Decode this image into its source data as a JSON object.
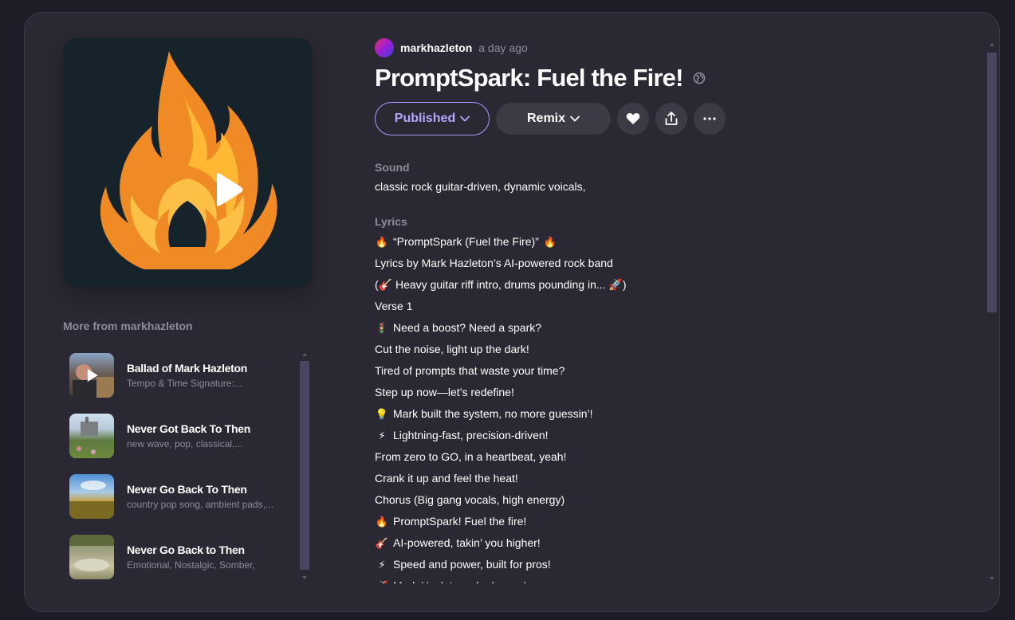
{
  "song": {
    "author": "markhazleton",
    "time": "a day ago",
    "title": "PromptSpark: Fuel the Fire!"
  },
  "actions": {
    "published_label": "Published",
    "remix_label": "Remix"
  },
  "sound": {
    "label": "Sound",
    "text": "classic rock guitar-driven, dynamic voicals,"
  },
  "lyrics": {
    "label": "Lyrics",
    "lines": [
      {
        "pre": "🔥",
        "text": "“PromptSpark (Fuel the Fire)”",
        "post": "🔥"
      },
      {
        "pre": "",
        "text": "Lyrics by Mark Hazleton’s AI-powered rock band",
        "post": ""
      },
      {
        "pre": "",
        "text": "(🎸 Heavy guitar riff intro, drums pounding in... 🚀)",
        "post": ""
      },
      {
        "pre": "",
        "text": "Verse 1",
        "post": ""
      },
      {
        "pre": "🚦",
        "text": "Need a boost? Need a spark?",
        "post": ""
      },
      {
        "pre": "",
        "text": "Cut the noise, light up the dark!",
        "post": ""
      },
      {
        "pre": "",
        "text": "Tired of prompts that waste your time?",
        "post": ""
      },
      {
        "pre": "",
        "text": "Step up now—let’s redefine!",
        "post": ""
      },
      {
        "pre": "💡",
        "text": "Mark built the system, no more guessin’!",
        "post": ""
      },
      {
        "pre": "⚡",
        "text": "Lightning-fast, precision-driven!",
        "post": ""
      },
      {
        "pre": "",
        "text": "From zero to GO, in a heartbeat, yeah!",
        "post": ""
      },
      {
        "pre": "",
        "text": "Crank it up and feel the heat!",
        "post": ""
      },
      {
        "pre": "",
        "text": "Chorus (Big gang vocals, high energy)",
        "post": ""
      },
      {
        "pre": "🔥",
        "text": "PromptSpark! Fuel the fire!",
        "post": ""
      },
      {
        "pre": "🎸",
        "text": "AI-powered, takin’ you higher!",
        "post": ""
      },
      {
        "pre": "⚡",
        "text": "Speed and power, built for pros!",
        "post": ""
      },
      {
        "pre": "🚀",
        "text": "Mark Hazleton—he knows!",
        "post": ""
      }
    ]
  },
  "more": {
    "title": "More from markhazleton",
    "items": [
      {
        "title": "Ballad of Mark Hazleton",
        "subtitle": "Tempo & Time Signature:..."
      },
      {
        "title": "Never Got Back To Then",
        "subtitle": "new wave, pop, classical,..."
      },
      {
        "title": "Never Go Back To Then",
        "subtitle": "country pop song, ambient pads,..."
      },
      {
        "title": "Never Go Back to Then",
        "subtitle": "Emotional, Nostalgic, Somber,"
      }
    ]
  },
  "colors": {
    "accent": "#a59cff",
    "background": "#1e1c26",
    "panel": "#2a2832"
  }
}
